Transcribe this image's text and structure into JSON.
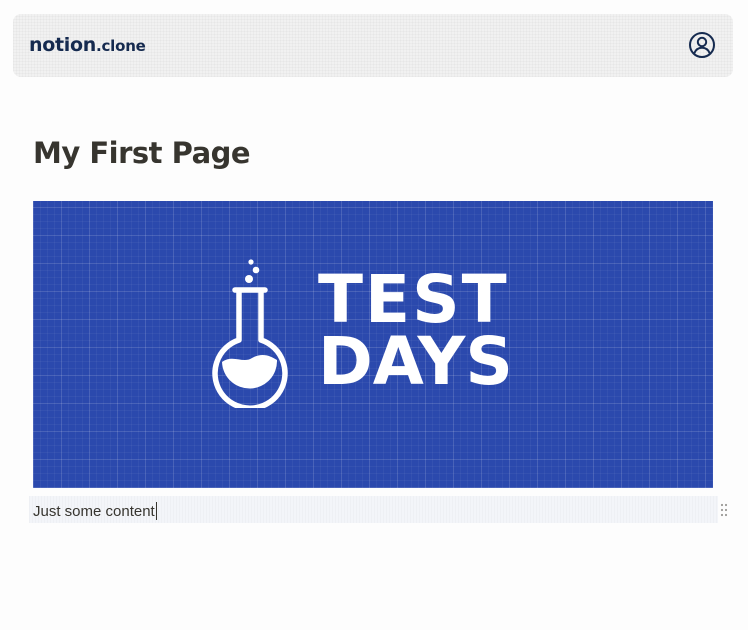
{
  "app": {
    "logo_main": "notion",
    "logo_suffix": ".clone"
  },
  "header": {
    "user_icon": "user-circle-icon"
  },
  "document": {
    "title": "My First Page",
    "banner": {
      "line1": "TEST",
      "line2": "DAYS",
      "icon": "flask-icon",
      "background_color": "#2b49ad"
    },
    "blocks": [
      {
        "text": "Just some content"
      }
    ],
    "drag_handle_icon": "drag-handle-icon"
  },
  "colors": {
    "brand": "#152a4f",
    "text": "#37352f",
    "banner": "#2b49ad"
  }
}
